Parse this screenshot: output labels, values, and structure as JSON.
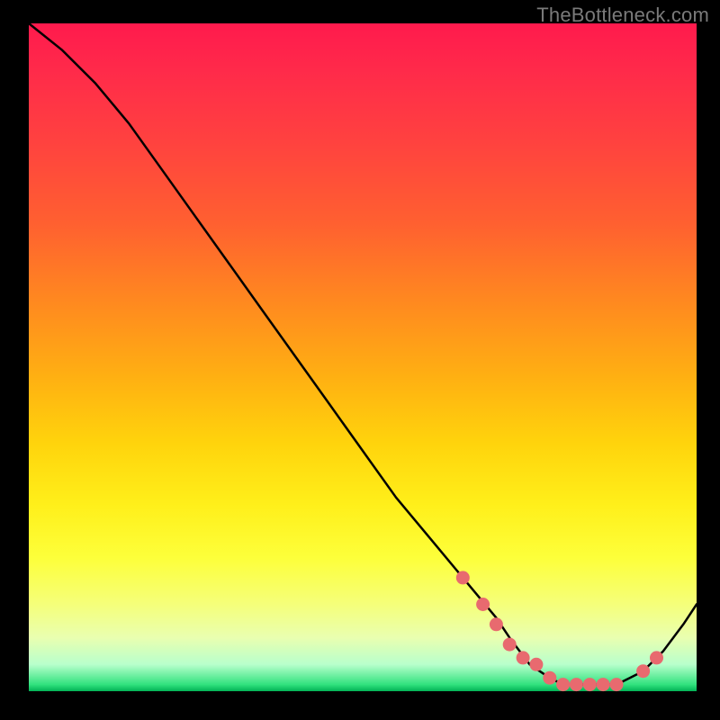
{
  "attribution": "TheBottleneck.com",
  "chart_data": {
    "type": "line",
    "title": "",
    "xlabel": "",
    "ylabel": "",
    "xlim": [
      0,
      100
    ],
    "ylim": [
      0,
      100
    ],
    "series": [
      {
        "name": "bottleneck-curve",
        "x": [
          0,
          5,
          10,
          15,
          20,
          25,
          30,
          35,
          40,
          45,
          50,
          55,
          60,
          65,
          70,
          72,
          75,
          78,
          80,
          82,
          85,
          88,
          90,
          92,
          95,
          98,
          100
        ],
        "y": [
          100,
          96,
          91,
          85,
          78,
          71,
          64,
          57,
          50,
          43,
          36,
          29,
          23,
          17,
          11,
          8,
          4,
          2,
          1,
          1,
          1,
          1,
          2,
          3,
          6,
          10,
          13
        ]
      }
    ],
    "markers": {
      "name": "highlight-points",
      "x": [
        65,
        68,
        70,
        72,
        74,
        76,
        78,
        80,
        82,
        84,
        86,
        88,
        92,
        94
      ],
      "y": [
        17,
        13,
        10,
        7,
        5,
        4,
        2,
        1,
        1,
        1,
        1,
        1,
        3,
        5
      ]
    },
    "colors": {
      "curve": "#000000",
      "markers": "#e86a6f",
      "gradient_top": "#ff1a4d",
      "gradient_mid": "#ffe01a",
      "gradient_bottom": "#02b356"
    }
  }
}
